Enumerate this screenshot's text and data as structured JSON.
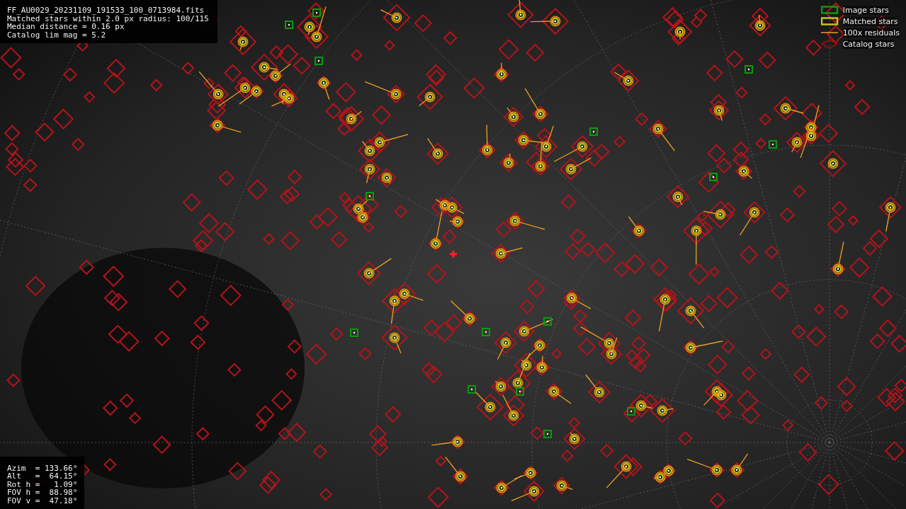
{
  "file_info": {
    "lines": [
      "FF_AU0029_20231109_191533_100_0713984.fits",
      "Matched stars within 2.0 px radius: 100/115",
      "Median distance = 0.16 px",
      "Catalog lim mag = 5.2"
    ]
  },
  "pointing": {
    "lines": [
      "Azim  = 133.66°",
      "Alt   =  64.15°",
      "Rot h =   1.09°",
      "FOV h =  88.98°",
      "FOV v =  47.18°"
    ]
  },
  "legend": [
    {
      "kind": "image",
      "label": "Image stars"
    },
    {
      "kind": "matched",
      "label": "Matched stars"
    },
    {
      "kind": "residual",
      "label": "100x residuals"
    },
    {
      "kind": "catalog",
      "label": "Catalog stars"
    }
  ]
}
